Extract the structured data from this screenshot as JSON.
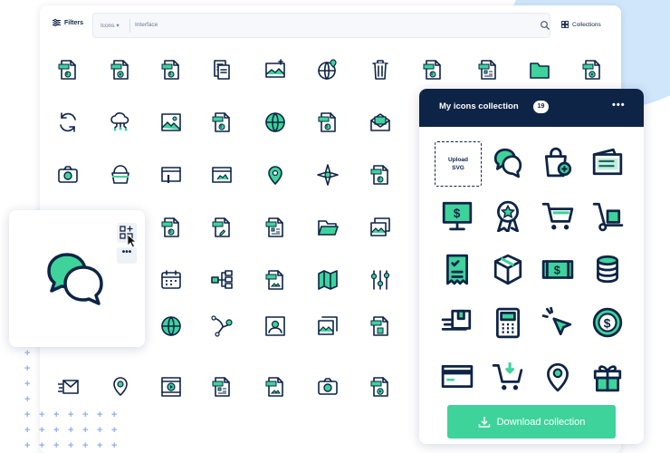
{
  "toolbar": {
    "filters_label": "Filters",
    "select_label": "Icons",
    "search_query": "Interface",
    "collections_label": "Collections"
  },
  "grid_icons": [
    "audio-file-icon",
    "video-file-icon",
    "audio-file-icon",
    "documents-icon",
    "landscape-image-icon",
    "globe-pin-icon",
    "trash-can-icon",
    "audio-file-icon",
    "document-chart-icon",
    "folder-icon",
    "video-file-icon",
    "sync-icon",
    "cloud-network-icon",
    "image-icon",
    "audio-file-icon",
    "globe-icon",
    "audio-file-icon",
    "envelope-icon",
    "camera-icon",
    "basket-icon",
    "browser-edit-icon",
    "browser-image-icon",
    "map-pin-icon",
    "compass-icon",
    "audio-file-icon",
    "audio-file-icon",
    "edit-file-icon",
    "document-chart-icon",
    "folder-open-icon",
    "image-gallery-icon",
    "calendar-icon",
    "hierarchy-icon",
    "image-file-icon",
    "folded-map-icon",
    "sliders-icon",
    "globe-icon",
    "vector-path-icon",
    "user-profile-icon",
    "image-stack-icon",
    "settings-file-icon",
    "send-mail-icon",
    "location-pin-icon",
    "video-player-icon",
    "document-chart-icon",
    "image-file-icon",
    "camera-icon",
    "video-file-icon"
  ],
  "collection": {
    "title": "My icons collection",
    "count": "19",
    "more": "•••",
    "upload_label_1": "Upload",
    "upload_label_2": "SVG",
    "icons": [
      "chat-bubbles-icon",
      "shopping-bag-add-icon",
      "wallet-icon",
      "dollar-monitor-icon",
      "award-ribbon-icon",
      "shopping-cart-icon",
      "hand-truck-icon",
      "receipt-icon",
      "package-box-icon",
      "cash-icon",
      "coin-stack-icon",
      "fast-delivery-icon",
      "calculator-icon",
      "pointer-click-icon",
      "dollar-circle-icon",
      "credit-card-icon",
      "cart-download-icon",
      "location-pin-icon",
      "gift-icon"
    ],
    "download_label": "Download collection"
  },
  "preview_card": {
    "icon": "chat-bubbles-icon",
    "more": "•••"
  },
  "colors": {
    "navy": "#0e2446",
    "accent": "#3ed39b",
    "blob": "#cfe6fb"
  }
}
